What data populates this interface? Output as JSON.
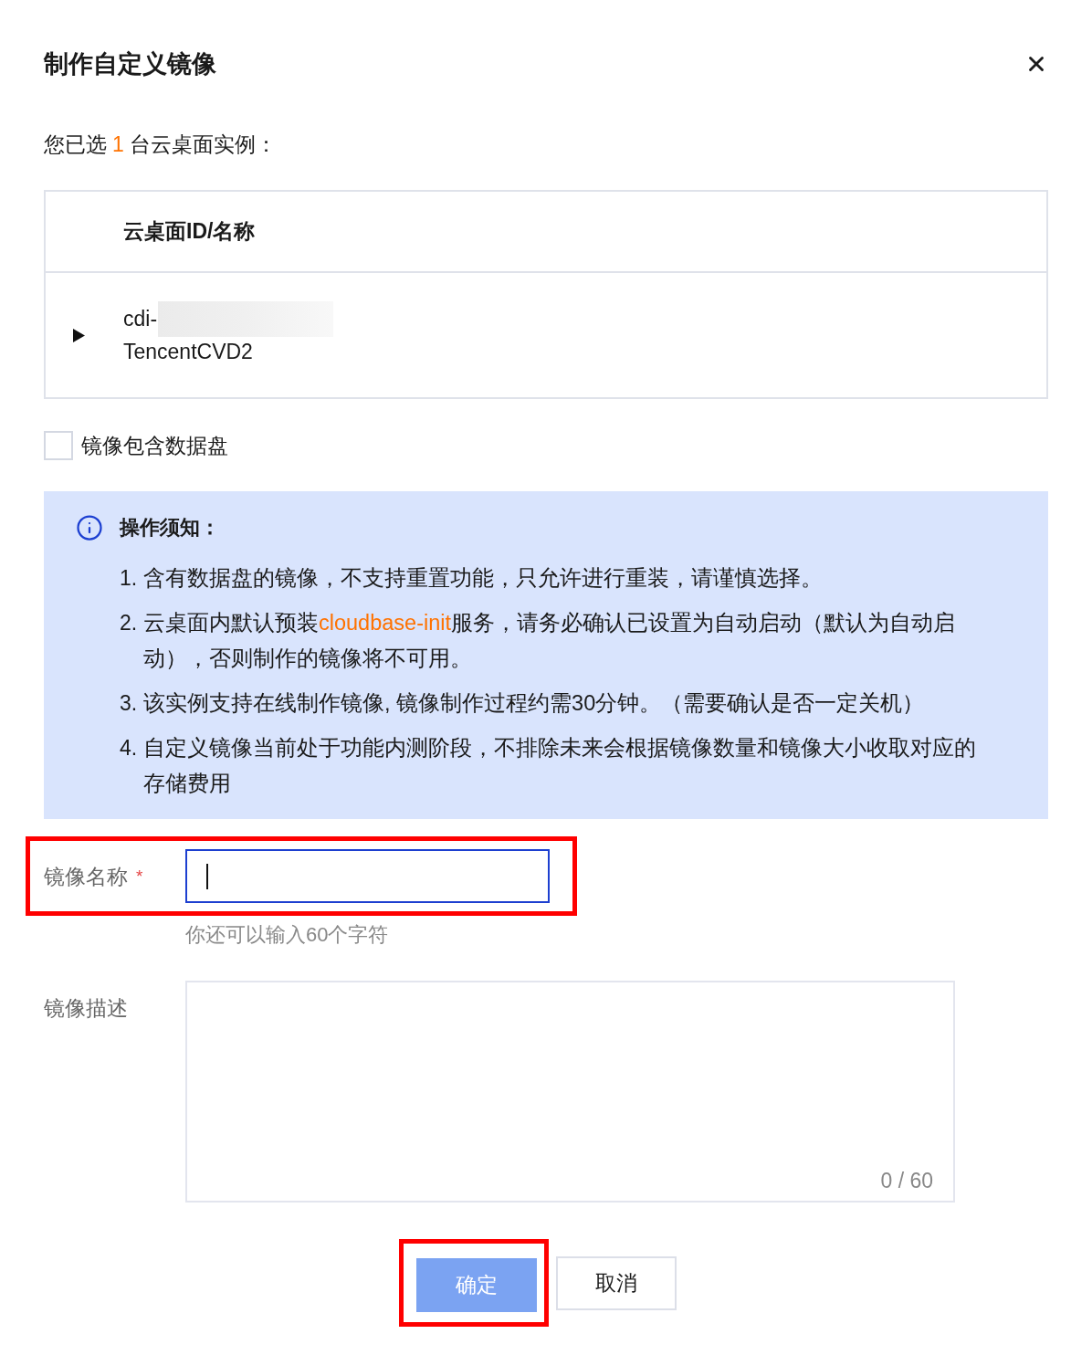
{
  "dialog": {
    "title": "制作自定义镜像"
  },
  "selection_summary": {
    "prefix": "您已选",
    "count": "1",
    "suffix": "台云桌面实例："
  },
  "table": {
    "columns": [
      "云桌面ID/名称"
    ],
    "rows": [
      {
        "expanded": false,
        "id": "cdi-",
        "redacted": true,
        "name": "TencentCVD2"
      }
    ]
  },
  "data_disk_checkbox": {
    "label": "镜像包含数据盘",
    "checked": false
  },
  "notice": {
    "title": "操作须知：",
    "items": [
      {
        "number": "1.",
        "segments": [
          {
            "kind": "plain",
            "text": "含有数据盘的镜像，不支持重置功能，只允许进行重装，请谨慎选择。"
          }
        ]
      },
      {
        "number": "2.",
        "segments": [
          {
            "kind": "plain",
            "text": "云桌面内默认预装"
          },
          {
            "kind": "link",
            "text": "cloudbase-init"
          },
          {
            "kind": "plain",
            "text": "服务，请务必确认已设置为自动启动（默认为自动启动），否则制作的镜像将不可用。"
          }
        ]
      },
      {
        "number": "3.",
        "segments": [
          {
            "kind": "plain",
            "text": "该实例支持在线制作镜像, 镜像制作过程约需30分钟。（需要确认是否一定关机）"
          }
        ]
      },
      {
        "number": "4.",
        "segments": [
          {
            "kind": "plain",
            "text": "自定义镜像当前处于功能内测阶段，不排除未来会根据镜像数量和镜像大小收取对应的存储费用"
          }
        ]
      }
    ]
  },
  "form": {
    "name_field": {
      "label": "镜像名称",
      "required_mark": "*",
      "focused": true,
      "highlighted": true,
      "hint": "你还可以输入60个字符"
    },
    "description_field": {
      "label": "镜像描述",
      "counter": "0 / 60"
    }
  },
  "buttons": [
    {
      "label": "确定",
      "kind": "primary",
      "disabled": true,
      "highlighted": true
    },
    {
      "label": "取消",
      "kind": "secondary",
      "disabled": false,
      "highlighted": false
    }
  ]
}
